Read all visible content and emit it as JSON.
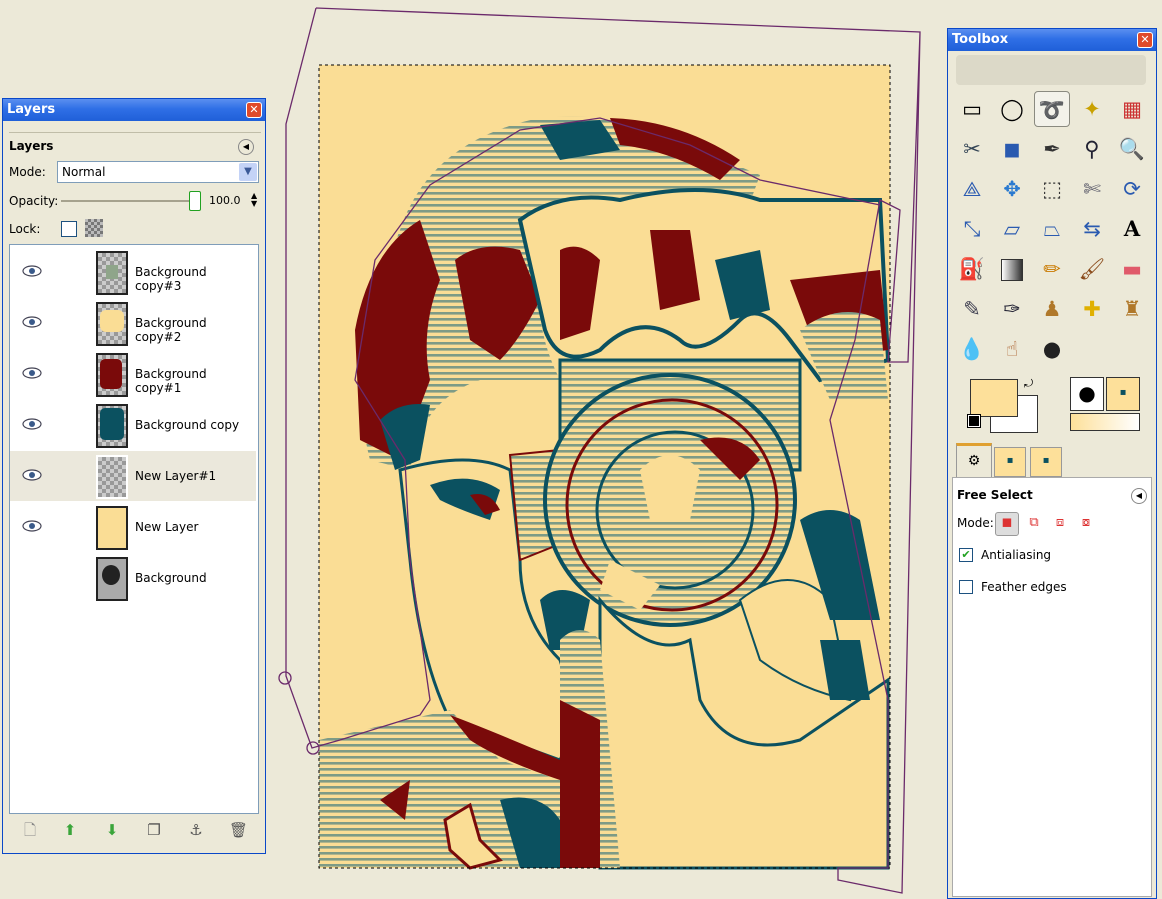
{
  "layers_panel": {
    "window_title": "Layers",
    "heading": "Layers",
    "mode_label": "Mode:",
    "mode_value": "Normal",
    "opacity_label": "Opacity:",
    "opacity_value": "100.0",
    "opacity_level": 1.0,
    "lock_label": "Lock:",
    "layers": [
      {
        "name": "Background copy#3",
        "visible": true
      },
      {
        "name": "Background copy#2",
        "visible": true
      },
      {
        "name": "Background copy#1",
        "visible": true
      },
      {
        "name": "Background copy",
        "visible": true
      },
      {
        "name": "New Layer#1",
        "visible": true,
        "selected": true
      },
      {
        "name": "New Layer",
        "visible": true
      },
      {
        "name": "Background",
        "visible": false
      }
    ],
    "bottom_icons": [
      "new-layer-icon",
      "raise-layer-icon",
      "lower-layer-icon",
      "duplicate-layer-icon",
      "anchor-layer-icon",
      "delete-layer-icon"
    ]
  },
  "toolbox": {
    "window_title": "Toolbox",
    "tool_options_title": "Free Select",
    "mode_label": "Mode:",
    "antialiasing_label": "Antialiasing",
    "antialiasing_checked": true,
    "feather_label": "Feather edges",
    "feather_checked": false,
    "tools": [
      "rect-select-icon",
      "ellipse-select-icon",
      "free-select-icon",
      "fuzzy-select-icon",
      "select-by-color-icon",
      "scissors-icon",
      "foreground-select-icon",
      "paths-icon",
      "color-picker-icon",
      "zoom-icon",
      "measure-icon",
      "move-icon",
      "align-icon",
      "crop-icon",
      "rotate-icon",
      "scale-icon",
      "shear-icon",
      "perspective-icon",
      "flip-icon",
      "text-icon",
      "bucket-fill-icon",
      "blend-icon",
      "pencil-icon",
      "paintbrush-icon",
      "eraser-icon",
      "airbrush-icon",
      "ink-icon",
      "clone-icon",
      "heal-icon",
      "perspective-clone-icon",
      "blur-icon",
      "smudge-icon",
      "dodge-burn-icon"
    ],
    "fg_color": "#fde09a",
    "bg_color": "#ffffff"
  },
  "colors": {
    "cream": "#fadd95",
    "red": "#7a0a0a",
    "teal": "#0b5160",
    "stripe": "#8fa58a"
  }
}
